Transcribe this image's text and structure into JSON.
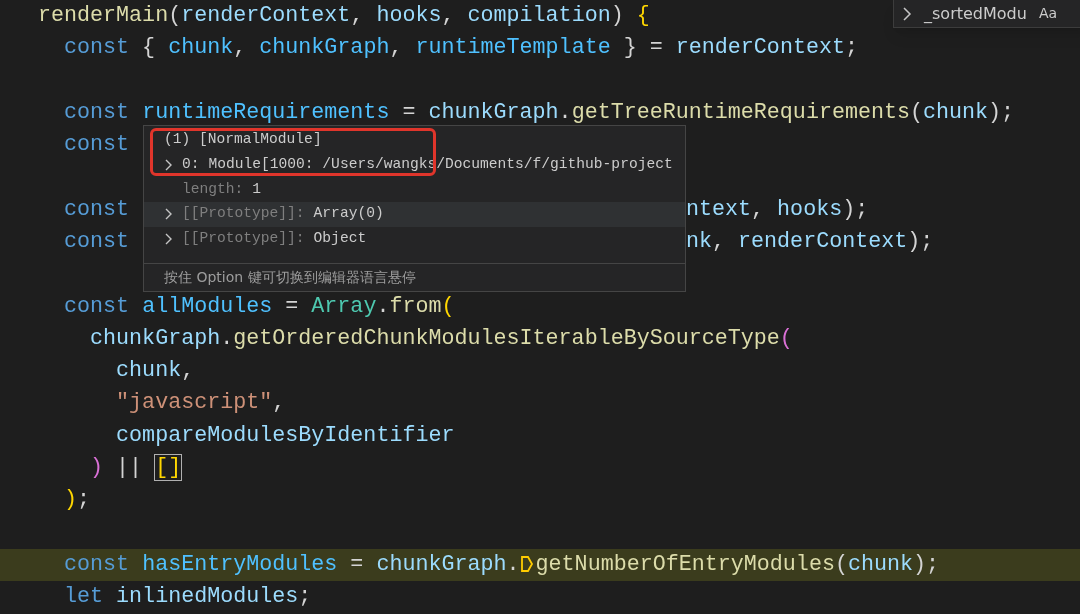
{
  "find_widget": {
    "value": "_sortedModu",
    "case_toggle": "Aa"
  },
  "code_lines": [
    {
      "highlighted": false,
      "tokens": [
        {
          "kind": "fn",
          "text": "renderMain"
        },
        {
          "kind": "punct",
          "text": "("
        },
        {
          "kind": "var",
          "text": "renderContext"
        },
        {
          "kind": "punct",
          "text": ", "
        },
        {
          "kind": "var",
          "text": "hooks"
        },
        {
          "kind": "punct",
          "text": ", "
        },
        {
          "kind": "var",
          "text": "compilation"
        },
        {
          "kind": "punct",
          "text": ") "
        },
        {
          "kind": "brace",
          "text": "{"
        }
      ]
    },
    {
      "highlighted": false,
      "tokens": [
        {
          "kind": "kw",
          "text": "  const"
        },
        {
          "kind": "punct",
          "text": " { "
        },
        {
          "kind": "const",
          "text": "chunk"
        },
        {
          "kind": "punct",
          "text": ", "
        },
        {
          "kind": "const",
          "text": "chunkGraph"
        },
        {
          "kind": "punct",
          "text": ", "
        },
        {
          "kind": "const",
          "text": "runtimeTemplate"
        },
        {
          "kind": "punct",
          "text": " } = "
        },
        {
          "kind": "var",
          "text": "renderContext"
        },
        {
          "kind": "punct",
          "text": ";"
        }
      ]
    },
    {
      "highlighted": false
    },
    {
      "highlighted": false,
      "tokens": [
        {
          "kind": "kw",
          "text": "  const "
        },
        {
          "kind": "const",
          "text": "runtimeRequirements"
        },
        {
          "kind": "punct",
          "text": " = "
        },
        {
          "kind": "var",
          "text": "chunkGraph"
        },
        {
          "kind": "punct",
          "text": "."
        },
        {
          "kind": "fn",
          "text": "getTreeRuntimeRequirements"
        },
        {
          "kind": "punct",
          "text": "("
        },
        {
          "kind": "var",
          "text": "chunk"
        },
        {
          "kind": "punct",
          "text": ");"
        }
      ]
    },
    {
      "highlighted": false,
      "tokens": [
        {
          "kind": "kw",
          "text": "  const"
        }
      ]
    },
    {
      "highlighted": false
    },
    {
      "highlighted": false,
      "tokens": [
        {
          "kind": "kw",
          "text": "  const"
        }
      ],
      "after_popup": [
        {
          "kind": "var",
          "text": "ntext"
        },
        {
          "kind": "punct",
          "text": ", "
        },
        {
          "kind": "var",
          "text": "hooks"
        },
        {
          "kind": "punct",
          "text": ");"
        }
      ]
    },
    {
      "highlighted": false,
      "tokens": [
        {
          "kind": "kw",
          "text": "  const"
        }
      ],
      "after_popup": [
        {
          "kind": "var",
          "text": "nk"
        },
        {
          "kind": "punct",
          "text": ", "
        },
        {
          "kind": "var",
          "text": "renderContext"
        },
        {
          "kind": "punct",
          "text": ");"
        }
      ]
    },
    {
      "highlighted": false
    },
    {
      "highlighted": false,
      "tokens": [
        {
          "kind": "kw",
          "text": "  const "
        },
        {
          "kind": "const",
          "text": "allModules"
        },
        {
          "kind": "punct",
          "text": " = "
        },
        {
          "kind": "type",
          "text": "Array"
        },
        {
          "kind": "punct",
          "text": "."
        },
        {
          "kind": "fn",
          "text": "from"
        },
        {
          "kind": "brace",
          "text": "("
        }
      ]
    },
    {
      "highlighted": false,
      "tokens": [
        {
          "kind": "var",
          "text": "    chunkGraph"
        },
        {
          "kind": "punct",
          "text": "."
        },
        {
          "kind": "fn",
          "text": "getOrderedChunkModulesIterableBySourceType"
        },
        {
          "kind": "paren",
          "text": "("
        }
      ]
    },
    {
      "highlighted": false,
      "tokens": [
        {
          "kind": "var",
          "text": "      chunk"
        },
        {
          "kind": "punct",
          "text": ","
        }
      ]
    },
    {
      "highlighted": false,
      "tokens": [
        {
          "kind": "str",
          "text": "      \"javascript\""
        },
        {
          "kind": "punct",
          "text": ","
        }
      ]
    },
    {
      "highlighted": false,
      "tokens": [
        {
          "kind": "var",
          "text": "      compareModulesByIdentifier"
        }
      ]
    },
    {
      "highlighted": false,
      "tokens": [
        {
          "kind": "paren",
          "text": "    )"
        },
        {
          "kind": "punct",
          "text": " || "
        },
        {
          "kind": "match",
          "text": "[]"
        }
      ]
    },
    {
      "highlighted": false,
      "tokens": [
        {
          "kind": "brace",
          "text": "  )"
        },
        {
          "kind": "punct",
          "text": ";"
        }
      ]
    },
    {
      "highlighted": false
    },
    {
      "highlighted": true,
      "tokens": [
        {
          "kind": "kw",
          "text": "  const "
        },
        {
          "kind": "const",
          "text": "hasEntryModules"
        },
        {
          "kind": "punct",
          "text": " = "
        },
        {
          "kind": "var",
          "text": "chunkGraph"
        },
        {
          "kind": "punct",
          "text": "."
        },
        {
          "kind": "fn",
          "text": "getNumberOfEntryModules",
          "stopped": true
        },
        {
          "kind": "punct",
          "text": "("
        },
        {
          "kind": "var",
          "text": "chunk"
        },
        {
          "kind": "punct",
          "text": ");"
        }
      ]
    },
    {
      "highlighted": false,
      "tokens": [
        {
          "kind": "kw",
          "text": "  let "
        },
        {
          "kind": "var",
          "text": "inlinedModules"
        },
        {
          "kind": "punct",
          "text": ";"
        }
      ]
    }
  ],
  "hover": {
    "title": "(1) [NormalModule]",
    "rows": [
      {
        "kind": "expandable",
        "selected": false,
        "key": "0:",
        "value": "Module[1000: /Users/wangks/Documents/f/github-project"
      },
      {
        "kind": "property",
        "selected": false,
        "key": "length:",
        "value": "1"
      },
      {
        "kind": "expandable",
        "selected": true,
        "key": "[[Prototype]]:",
        "value": "Array(0)"
      },
      {
        "kind": "expandable",
        "selected": false,
        "key": "[[Prototype]]:",
        "value": "Object"
      }
    ],
    "hint": "按住 Option 键可切换到编辑器语言悬停"
  }
}
